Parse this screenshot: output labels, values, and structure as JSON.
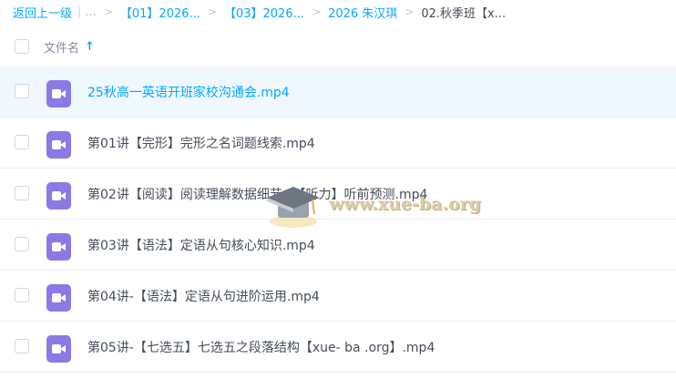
{
  "breadcrumb": {
    "back": "返回上一级",
    "ellipsis": "...",
    "crumbs": [
      "【01】2026...",
      "【03】2026...",
      "2026 朱汉琪"
    ],
    "current": "02.秋季班【x..."
  },
  "header": {
    "column_label": "文件名",
    "sort_icon": "arrow-up-icon"
  },
  "files": [
    {
      "name": "25秋高一英语开班家校沟通会.mp4",
      "icon": "video-icon",
      "active": true
    },
    {
      "name": "第01讲【完形】完形之名词题线索.mp4",
      "icon": "video-icon",
      "active": false
    },
    {
      "name": "第02讲【阅读】阅读理解数据细节+【听力】听前预测.mp4",
      "icon": "video-icon",
      "active": false
    },
    {
      "name": "第03讲【语法】定语从句核心知识.mp4",
      "icon": "video-icon",
      "active": false
    },
    {
      "name": "第04讲-【语法】定语从句进阶运用.mp4",
      "icon": "video-icon",
      "active": false
    },
    {
      "name": "第05讲-【七选五】七选五之段落结构【xue- ba .org】.mp4",
      "icon": "video-icon",
      "active": false
    }
  ],
  "watermark": {
    "text": "www.xue-ba.org"
  },
  "colors": {
    "accent": "#06a7ff",
    "video_icon": "#8a7ae6",
    "active_row": "#f0f8ff"
  }
}
